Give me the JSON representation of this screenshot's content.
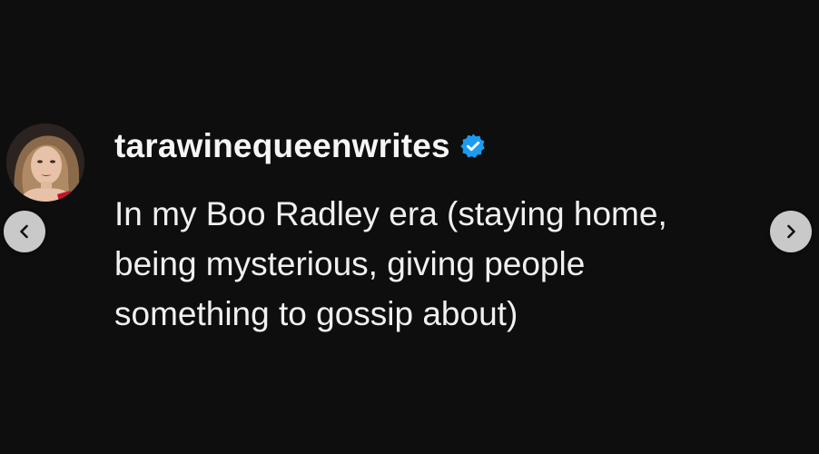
{
  "post": {
    "username": "tarawinequeenwrites",
    "verified": true,
    "text_lines": [
      "In my Boo Radley era (staying home,",
      "being mysterious, giving people",
      "something to gossip about)"
    ]
  },
  "navigation": {
    "prev_icon": "chevron-left-icon",
    "next_icon": "chevron-right-icon"
  },
  "colors": {
    "background": "#0e0e0e",
    "text": "#f0f0f0",
    "verified_badge": "#1d9bf0",
    "nav_button": "#c9c9c9"
  }
}
